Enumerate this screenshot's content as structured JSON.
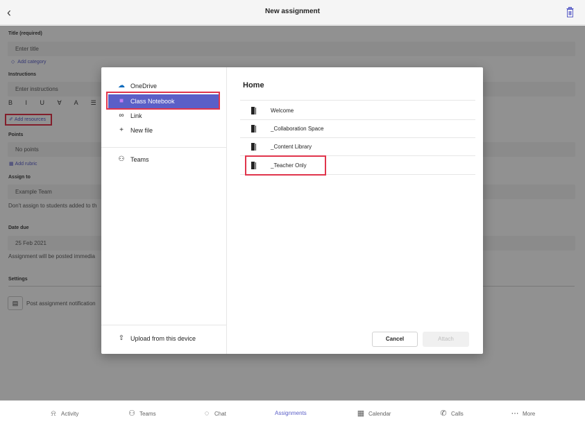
{
  "header": {
    "back_icon": "chevron-left-icon",
    "title": "New assignment",
    "trash_icon": "trash-icon"
  },
  "form": {
    "title_label": "Title (required)",
    "title_placeholder": "Enter title",
    "add_category": "Add category",
    "instructions_label": "Instructions",
    "instructions_placeholder": "Enter instructions",
    "format_tools": "B I U ∀ A ☰",
    "add_resources": "Add resources",
    "points_label": "Points",
    "points_value": "No points",
    "add_rubric": "Add rubric",
    "assign_label": "Assign to",
    "assign_value": "Example Team",
    "assign_note": "Don't assign to students added to th",
    "date_label": "Date due",
    "date_value": "25 Feb 2021",
    "date_note": "Assignment will be posted immedia",
    "settings_label": "Settings",
    "notification_text": "Post assignment notification"
  },
  "dialog": {
    "sources": [
      {
        "label": "OneDrive",
        "icon": "cloud-icon"
      },
      {
        "label": "Class Notebook",
        "icon": "onenote-icon",
        "selected": true
      },
      {
        "label": "Link",
        "icon": "link-icon"
      },
      {
        "label": "New file",
        "icon": "plus-icon"
      },
      {
        "label": "Teams",
        "icon": "teams-icon"
      },
      {
        "label": "Upload from this device",
        "icon": "upload-icon"
      }
    ],
    "home_title": "Home",
    "notebook_items": [
      "Welcome",
      "_Collaboration Space",
      "_Content Library",
      "_Teacher Only"
    ],
    "cancel_label": "Cancel",
    "attach_label": "Attach"
  },
  "nav": {
    "items": [
      {
        "label": "Activity",
        "icon": "bell-icon"
      },
      {
        "label": "Teams",
        "icon": "teams-icon"
      },
      {
        "label": "Chat",
        "icon": "chat-icon"
      },
      {
        "label": "Assignments",
        "icon": "assignments-icon",
        "active": true
      },
      {
        "label": "Calendar",
        "icon": "calendar-icon"
      },
      {
        "label": "Calls",
        "icon": "phone-icon"
      },
      {
        "label": "More",
        "icon": "more-icon"
      }
    ]
  },
  "colors": {
    "accent": "#5b5fc7",
    "highlight": "#e0344b"
  }
}
